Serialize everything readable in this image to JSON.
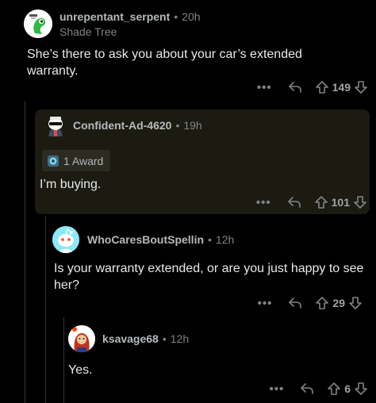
{
  "comments": [
    {
      "username": "unrepentant_serpent",
      "separator": "•",
      "time": "20h",
      "flair": "Shade Tree",
      "body": "She’s there to ask you about your car’s extended warranty.",
      "score": "149",
      "more": "•••",
      "avatar_color": "#ffffff"
    },
    {
      "username": "Confident-Ad-4620",
      "separator": "•",
      "time": "19h",
      "award": "1 Award",
      "body": "I’m buying.",
      "score": "101",
      "more": "•••",
      "highlight_color": "#1c1b12"
    },
    {
      "username": "WhoCaresBoutSpellin",
      "separator": "•",
      "time": "12h",
      "body": "Is your warranty extended, or are you just happy to see her?",
      "score": "29",
      "more": "•••",
      "avatar_color": "#8be8f7"
    },
    {
      "username": "ksavage68",
      "separator": "•",
      "time": "12h",
      "body": "Yes.",
      "score": "6",
      "more": "•••",
      "avatar_color": "#ffffff"
    }
  ],
  "icons": {
    "more": "more-options-icon",
    "reply": "reply-icon",
    "upvote": "upvote-icon",
    "downvote": "downvote-icon",
    "award": "award-icon"
  }
}
